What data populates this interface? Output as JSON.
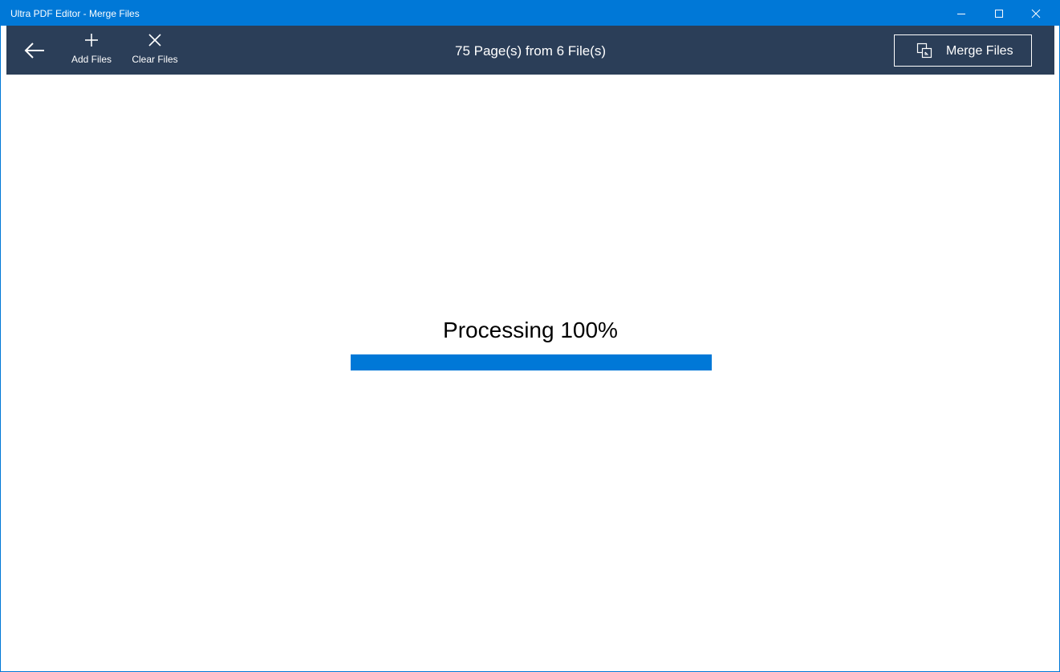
{
  "window": {
    "title": "Ultra PDF Editor - Merge Files",
    "controls": {
      "minimize_icon": "minimize-icon",
      "maximize_icon": "maximize-icon",
      "close_icon": "close-icon"
    }
  },
  "toolbar": {
    "back_icon": "back-arrow-icon",
    "add_files_label": "Add Files",
    "add_files_icon": "plus-icon",
    "clear_files_label": "Clear Files",
    "clear_files_icon": "close-icon",
    "summary": "75 Page(s) from 6 File(s)",
    "merge_label": "Merge Files",
    "merge_icon": "merge-icon"
  },
  "progress": {
    "text": "Processing 100%",
    "value": 1.0,
    "color": "#0078d7"
  },
  "colors": {
    "accent": "#0078d7",
    "toolbar_bg": "#2b3e58"
  }
}
